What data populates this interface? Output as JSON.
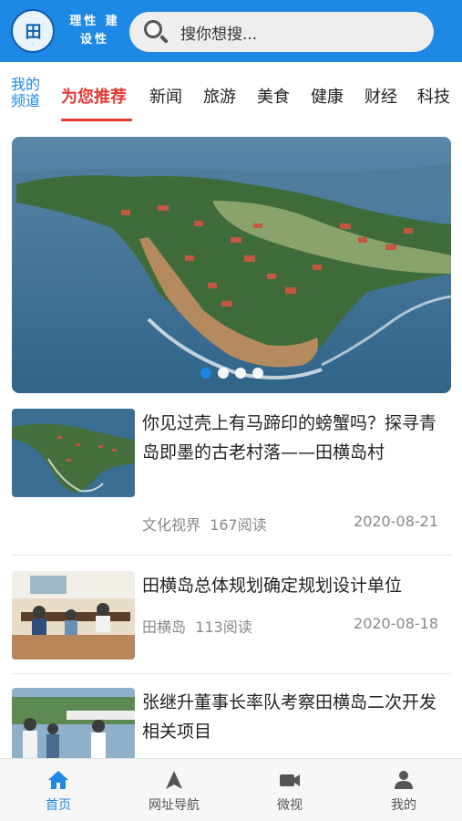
{
  "header": {
    "logo_icon": "logo-seal-icon",
    "slogan": "理性 建设性",
    "search_placeholder": "搜你想搜..."
  },
  "channels": {
    "my_channel": "我的频道",
    "tabs": [
      {
        "label": "为您推荐",
        "active": true
      },
      {
        "label": "新闻"
      },
      {
        "label": "旅游"
      },
      {
        "label": "美食"
      },
      {
        "label": "健康"
      },
      {
        "label": "财经"
      },
      {
        "label": "科技"
      }
    ]
  },
  "banner": {
    "slide_count": 4,
    "active_index": 0
  },
  "articles": [
    {
      "title": "你见过壳上有马蹄印的螃蟹吗？探寻青岛即墨的古老村落——田横岛村",
      "source": "文化视界",
      "reads": "167阅读",
      "date": "2020-08-21"
    },
    {
      "title": "田横岛总体规划确定规划设计单位",
      "source": "田横岛",
      "reads": "113阅读",
      "date": "2020-08-18"
    },
    {
      "title": "张继升董事长率队考察田横岛二次开发相关项目"
    }
  ],
  "bottom_nav": [
    {
      "label": "首页",
      "icon": "home-icon",
      "active": true
    },
    {
      "label": "网址导航",
      "icon": "navigation-arrow-icon"
    },
    {
      "label": "微视",
      "icon": "video-camera-icon"
    },
    {
      "label": "我的",
      "icon": "user-icon"
    }
  ],
  "colors": {
    "primary": "#1e88e5",
    "active_tab": "#e53935"
  }
}
